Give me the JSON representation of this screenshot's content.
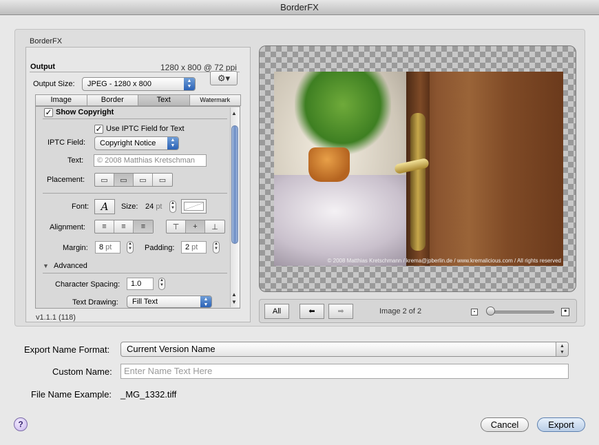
{
  "window": {
    "title": "BorderFX"
  },
  "plugin": {
    "name": "BorderFX",
    "version": "v1.1.1 (118)"
  },
  "output": {
    "label": "Output",
    "info": "1280 x 800 @ 72 ppi",
    "size_label": "Output Size:",
    "size_value": "JPEG - 1280 x 800",
    "gear_icon": "gear-icon"
  },
  "tabs": [
    {
      "label": "Image"
    },
    {
      "label": "Border"
    },
    {
      "label": "Text",
      "active": true
    },
    {
      "label": "Watermark"
    }
  ],
  "text_panel": {
    "show_copyright": {
      "label": "Show Copyright",
      "checked": true
    },
    "use_iptc": {
      "label": "Use IPTC Field for Text",
      "checked": true
    },
    "iptc_field_label": "IPTC Field:",
    "iptc_field_value": "Copyright Notice",
    "text_label": "Text:",
    "text_value": "© 2008 Matthias Kretschman",
    "placement_label": "Placement:",
    "font_label": "Font:",
    "font_glyph": "A",
    "size_label": "Size:",
    "size_value": "24",
    "size_unit": "pt",
    "alignment_label": "Alignment:",
    "margin_label": "Margin:",
    "margin_value": "8",
    "margin_unit": "pt",
    "padding_label": "Padding:",
    "padding_value": "2",
    "padding_unit": "pt",
    "advanced_label": "Advanced",
    "char_spacing_label": "Character Spacing:",
    "char_spacing_value": "1.0",
    "text_drawing_label": "Text Drawing:",
    "text_drawing_value": "Fill Text"
  },
  "preview": {
    "overlay_text": "© 2008 Matthias Kretschmann / krema@jpberlin.de / www.kremalicious.com / All rights reserved",
    "all_button": "All",
    "counter": "Image 2 of 2"
  },
  "export": {
    "name_format_label": "Export Name Format:",
    "name_format_value": "Current Version Name",
    "custom_name_label": "Custom Name:",
    "custom_name_placeholder": "Enter Name Text Here",
    "example_label": "File Name Example:",
    "example_value": "_MG_1332.tiff"
  },
  "buttons": {
    "help": "?",
    "cancel": "Cancel",
    "export": "Export"
  }
}
